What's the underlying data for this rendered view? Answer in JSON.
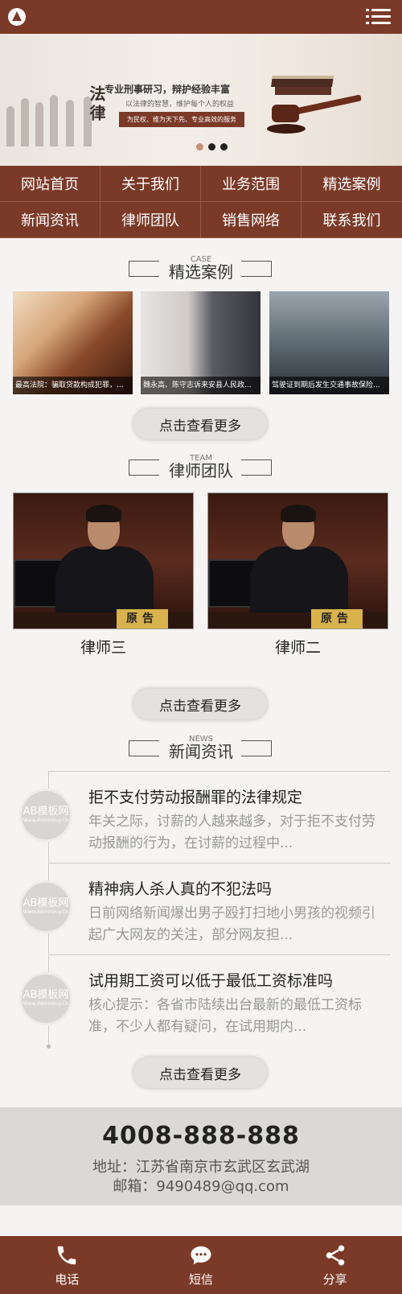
{
  "header": {
    "logo_icon": "logo-icon",
    "menu_icon": "hamburger-menu-icon"
  },
  "banner": {
    "headline": "专业刑事研习，辩护经验丰富",
    "subline": "以法律的智慧，维护每个人的权益",
    "tagline": "为民权、维为天下先、专业高效的服务",
    "calligraphy": "法律",
    "slides": 3,
    "active_slide": 0
  },
  "nav": {
    "items": [
      {
        "label": "网站首页"
      },
      {
        "label": "关于我们"
      },
      {
        "label": "业务范围"
      },
      {
        "label": "精选案例"
      },
      {
        "label": "新闻资讯"
      },
      {
        "label": "律师团队"
      },
      {
        "label": "销售网络"
      },
      {
        "label": "联系我们"
      }
    ]
  },
  "cases": {
    "en": "CASE",
    "title": "精选案例",
    "items": [
      {
        "caption": "最高法院：骗取贷款构成犯罪，..."
      },
      {
        "caption": "魏永高、陈守志诉来安县人民政..."
      },
      {
        "caption": "驾驶证到期后发生交通事故保险..."
      }
    ],
    "more": "点击查看更多"
  },
  "team": {
    "en": "TEAM",
    "title": "律师团队",
    "members": [
      {
        "name": "律师三",
        "sign": "原告"
      },
      {
        "name": "律师二",
        "sign": "原告"
      }
    ],
    "more": "点击查看更多"
  },
  "news": {
    "en": "NEWS",
    "title": "新闻资讯",
    "badge_top": "AB模板网",
    "badge_bottom": "Www.Adminbuy.Cn",
    "items": [
      {
        "title": "拒不支付劳动报酬罪的法律规定",
        "desc": "年关之际，讨薪的人越来越多，对于拒不支付劳动报酬的行为，在讨薪的过程中..."
      },
      {
        "title": "精神病人杀人真的不犯法吗",
        "desc": "日前网络新闻爆出男子殴打扫地小男孩的视频引起广大网友的关注，部分网友担..."
      },
      {
        "title": "试用期工资可以低于最低工资标准吗",
        "desc": "核心提示：各省市陆续出台最新的最低工资标准，不少人都有疑问，在试用期内..."
      }
    ],
    "more": "点击查看更多"
  },
  "contact": {
    "phone": "4008-888-888",
    "address": "地址：江苏省南京市玄武区玄武湖",
    "email": "邮箱：9490489@qq.com"
  },
  "footer": {
    "items": [
      {
        "label": "电话",
        "icon": "phone-icon"
      },
      {
        "label": "短信",
        "icon": "message-icon"
      },
      {
        "label": "分享",
        "icon": "share-icon"
      }
    ]
  },
  "colors": {
    "brand": "#7b3a28",
    "background": "#f5f4f2",
    "contact_bg": "#dad9d7"
  }
}
